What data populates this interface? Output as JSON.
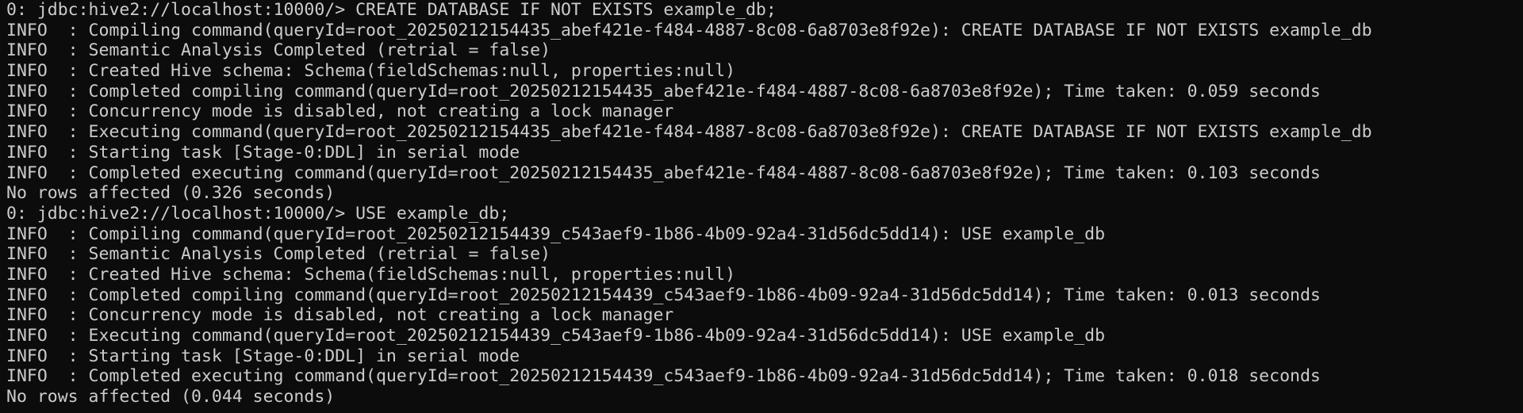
{
  "terminal": {
    "lines": [
      "0: jdbc:hive2://localhost:10000/> CREATE DATABASE IF NOT EXISTS example_db;",
      "INFO  : Compiling command(queryId=root_20250212154435_abef421e-f484-4887-8c08-6a8703e8f92e): CREATE DATABASE IF NOT EXISTS example_db",
      "INFO  : Semantic Analysis Completed (retrial = false)",
      "INFO  : Created Hive schema: Schema(fieldSchemas:null, properties:null)",
      "INFO  : Completed compiling command(queryId=root_20250212154435_abef421e-f484-4887-8c08-6a8703e8f92e); Time taken: 0.059 seconds",
      "INFO  : Concurrency mode is disabled, not creating a lock manager",
      "INFO  : Executing command(queryId=root_20250212154435_abef421e-f484-4887-8c08-6a8703e8f92e): CREATE DATABASE IF NOT EXISTS example_db",
      "INFO  : Starting task [Stage-0:DDL] in serial mode",
      "INFO  : Completed executing command(queryId=root_20250212154435_abef421e-f484-4887-8c08-6a8703e8f92e); Time taken: 0.103 seconds",
      "No rows affected (0.326 seconds)",
      "0: jdbc:hive2://localhost:10000/> USE example_db;",
      "INFO  : Compiling command(queryId=root_20250212154439_c543aef9-1b86-4b09-92a4-31d56dc5dd14): USE example_db",
      "INFO  : Semantic Analysis Completed (retrial = false)",
      "INFO  : Created Hive schema: Schema(fieldSchemas:null, properties:null)",
      "INFO  : Completed compiling command(queryId=root_20250212154439_c543aef9-1b86-4b09-92a4-31d56dc5dd14); Time taken: 0.013 seconds",
      "INFO  : Concurrency mode is disabled, not creating a lock manager",
      "INFO  : Executing command(queryId=root_20250212154439_c543aef9-1b86-4b09-92a4-31d56dc5dd14): USE example_db",
      "INFO  : Starting task [Stage-0:DDL] in serial mode",
      "INFO  : Completed executing command(queryId=root_20250212154439_c543aef9-1b86-4b09-92a4-31d56dc5dd14); Time taken: 0.018 seconds",
      "No rows affected (0.044 seconds)"
    ]
  },
  "colors": {
    "background": "#0c0c0c",
    "text": "#cccccc"
  }
}
